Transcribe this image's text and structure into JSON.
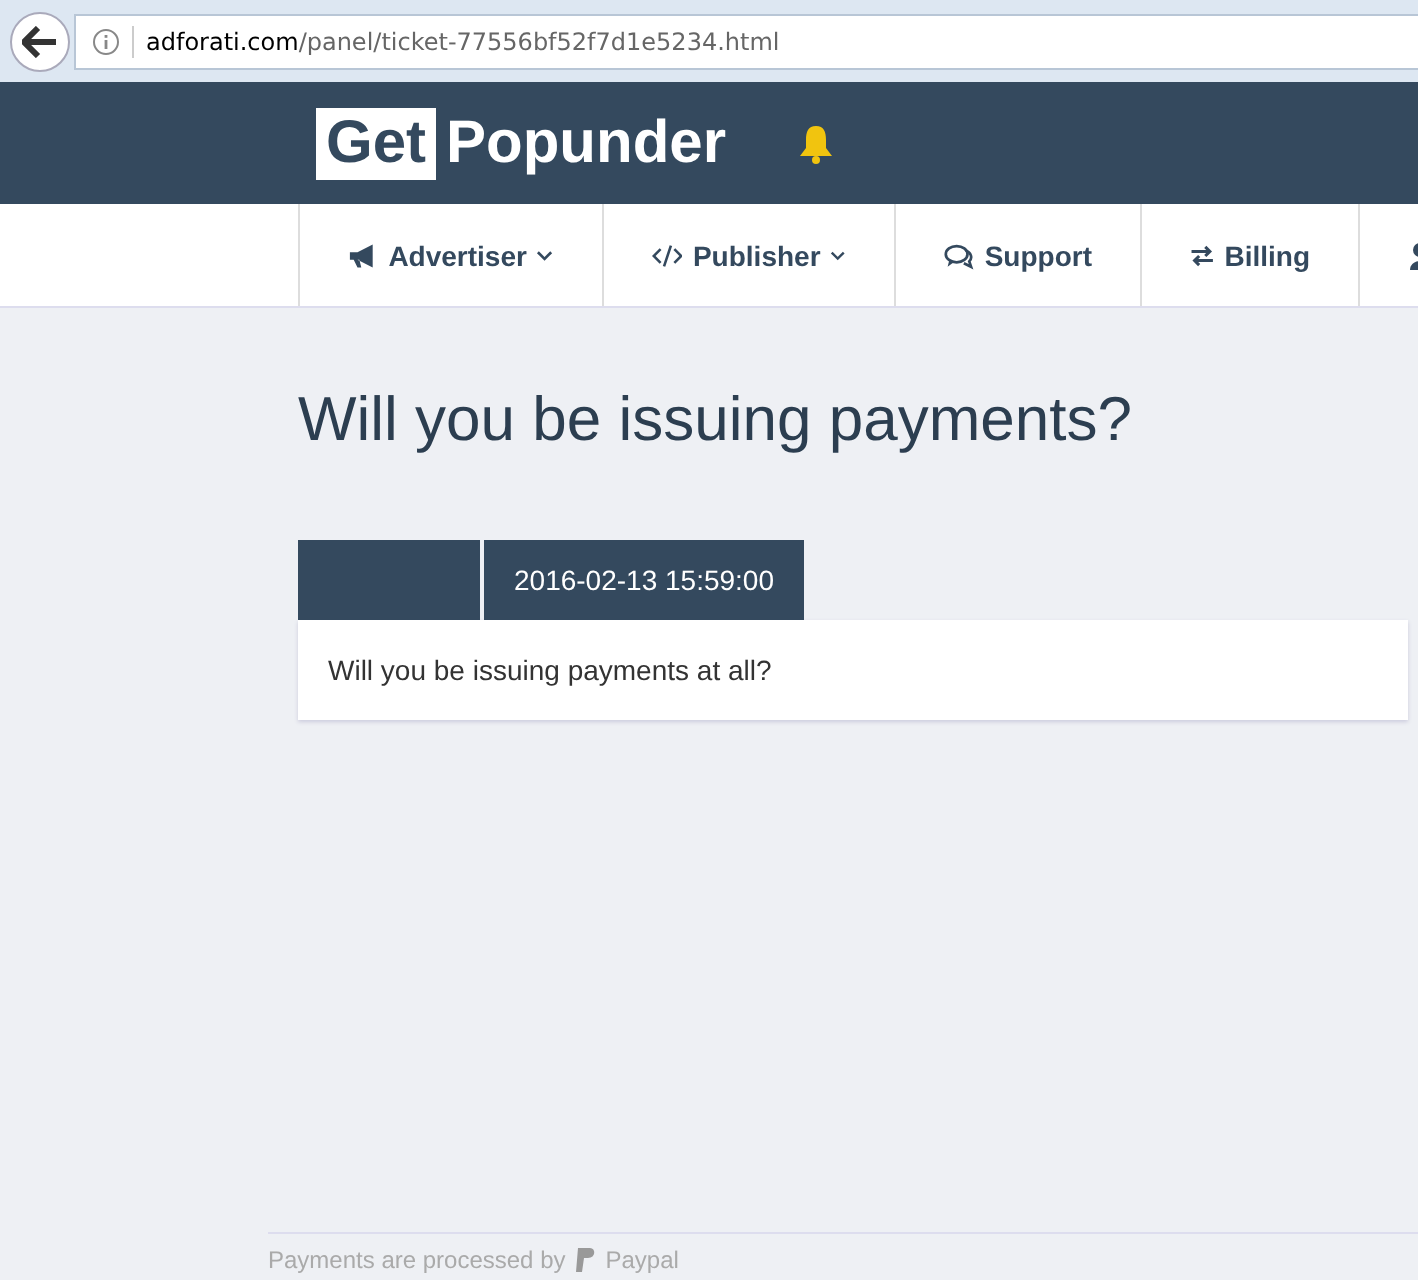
{
  "browser": {
    "url_host": "adforati.com",
    "url_path": "/panel/ticket-77556bf52f7d1e5234.html"
  },
  "header": {
    "logo_boxed": "Get",
    "logo_rest": "Popunder"
  },
  "nav": [
    {
      "kind": "advertiser",
      "label": "Advertiser",
      "dropdown": true
    },
    {
      "kind": "publisher",
      "label": "Publisher",
      "dropdown": true
    },
    {
      "kind": "support",
      "label": "Support",
      "dropdown": false
    },
    {
      "kind": "billing",
      "label": "Billing",
      "dropdown": false
    },
    {
      "kind": "user"
    }
  ],
  "page_title": "Will you be issuing payments?",
  "message": {
    "time": "2016-02-13 15:59:00",
    "body": "Will you be issuing payments at all?"
  },
  "footer": {
    "text": "Payments are processed by",
    "brand": "Paypal"
  }
}
